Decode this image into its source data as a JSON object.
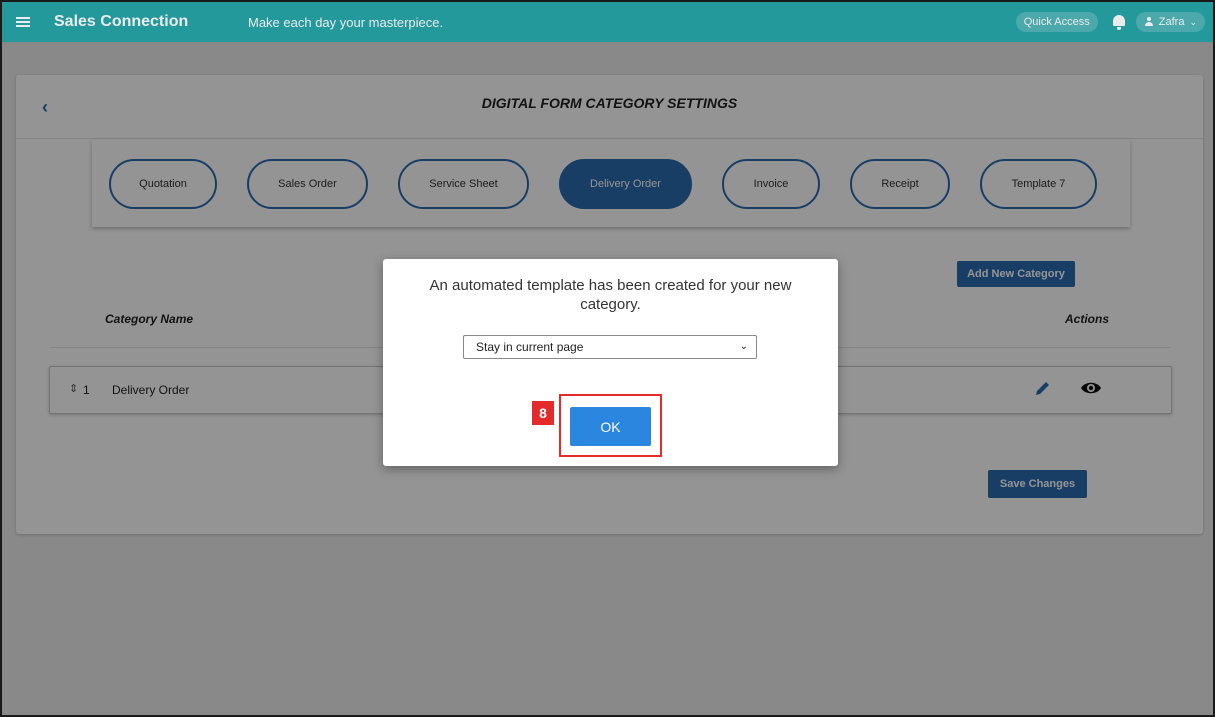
{
  "app": {
    "brand": "Sales Connection",
    "tagline": "Make each day your masterpiece.",
    "quick_access": "Quick Access",
    "user_name": "Zafra"
  },
  "page": {
    "title": "DIGITAL FORM CATEGORY SETTINGS",
    "tabs": [
      {
        "label": "Quotation",
        "active": false
      },
      {
        "label": "Sales Order",
        "active": false
      },
      {
        "label": "Service Sheet",
        "active": false
      },
      {
        "label": "Delivery Order",
        "active": true
      },
      {
        "label": "Invoice",
        "active": false
      },
      {
        "label": "Receipt",
        "active": false
      },
      {
        "label": "Template 7",
        "active": false
      }
    ],
    "add_category_label": "Add New Category",
    "columns": {
      "name": "Category Name",
      "actions": "Actions"
    },
    "rows": [
      {
        "index": "1",
        "name": "Delivery Order"
      }
    ],
    "save_label": "Save Changes"
  },
  "modal": {
    "message": "An automated template has been created for your new category.",
    "select_value": "Stay in current page",
    "ok_label": "OK",
    "step_badge": "8"
  },
  "colors": {
    "topbar": "#27a7aa",
    "primary": "#2b6cb0",
    "highlight": "#e32b2b"
  }
}
